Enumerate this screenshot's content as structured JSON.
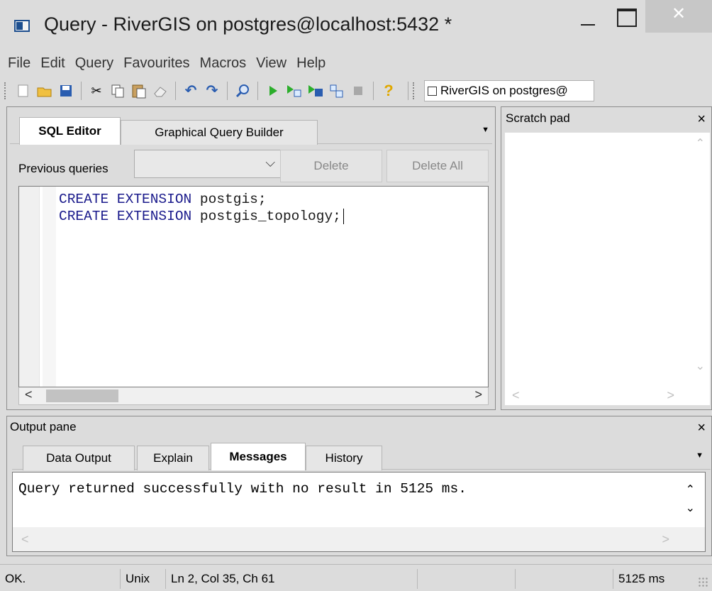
{
  "window": {
    "title": "Query - RiverGIS on postgres@localhost:5432 *",
    "icons": [
      "app-icon",
      "minimize-icon",
      "maximize-icon",
      "close-icon"
    ]
  },
  "menu": [
    "File",
    "Edit",
    "Query",
    "Favourites",
    "Macros",
    "View",
    "Help"
  ],
  "toolbar": {
    "buttons": [
      {
        "name": "new-icon",
        "glyph": "▫"
      },
      {
        "name": "open-icon",
        "glyph": "📂"
      },
      {
        "name": "save-icon",
        "glyph": "💾"
      },
      {
        "name": "cut-icon",
        "glyph": "✂"
      },
      {
        "name": "copy-icon",
        "glyph": "⧉"
      },
      {
        "name": "paste-icon",
        "glyph": "📋"
      },
      {
        "name": "eraser-icon",
        "glyph": "⌫"
      },
      {
        "name": "undo-icon",
        "glyph": "↶"
      },
      {
        "name": "redo-icon",
        "glyph": "↷"
      },
      {
        "name": "find-icon",
        "glyph": "⌕"
      },
      {
        "name": "execute-icon",
        "glyph": "▶"
      },
      {
        "name": "explain-icon",
        "glyph": "⇶"
      },
      {
        "name": "execute-to-file-icon",
        "glyph": "▶"
      },
      {
        "name": "explain-analyze-icon",
        "glyph": "⇉"
      },
      {
        "name": "stop-icon",
        "glyph": "■"
      },
      {
        "name": "help-icon",
        "glyph": "?"
      }
    ],
    "connection_label": "RiverGIS on postgres@"
  },
  "editor_tabs": [
    {
      "label": "SQL Editor",
      "active": true
    },
    {
      "label": "Graphical Query Builder",
      "active": false
    }
  ],
  "previous_queries": {
    "label": "Previous queries",
    "value": "",
    "delete_label": "Delete",
    "delete_all_label": "Delete All"
  },
  "editor": {
    "lines": [
      {
        "keyword": "CREATE EXTENSION",
        "rest": " postgis;"
      },
      {
        "keyword": "CREATE EXTENSION",
        "rest": " postgis_topology;"
      }
    ]
  },
  "scratch_pad": {
    "title": "Scratch pad",
    "close": "×"
  },
  "output_pane": {
    "title": "Output pane",
    "close": "×",
    "tabs": [
      {
        "label": "Data Output",
        "active": false
      },
      {
        "label": "Explain",
        "active": false
      },
      {
        "label": "Messages",
        "active": true
      },
      {
        "label": "History",
        "active": false
      }
    ],
    "message": "Query returned successfully with no result in 5125 ms."
  },
  "statusbar": {
    "status": "OK.",
    "line_endings": "Unix",
    "position": "Ln 2, Col 35, Ch 61",
    "elapsed": "5125 ms"
  },
  "colors": {
    "keyword": "#1b1b8c",
    "background": "#dcdcdc"
  }
}
